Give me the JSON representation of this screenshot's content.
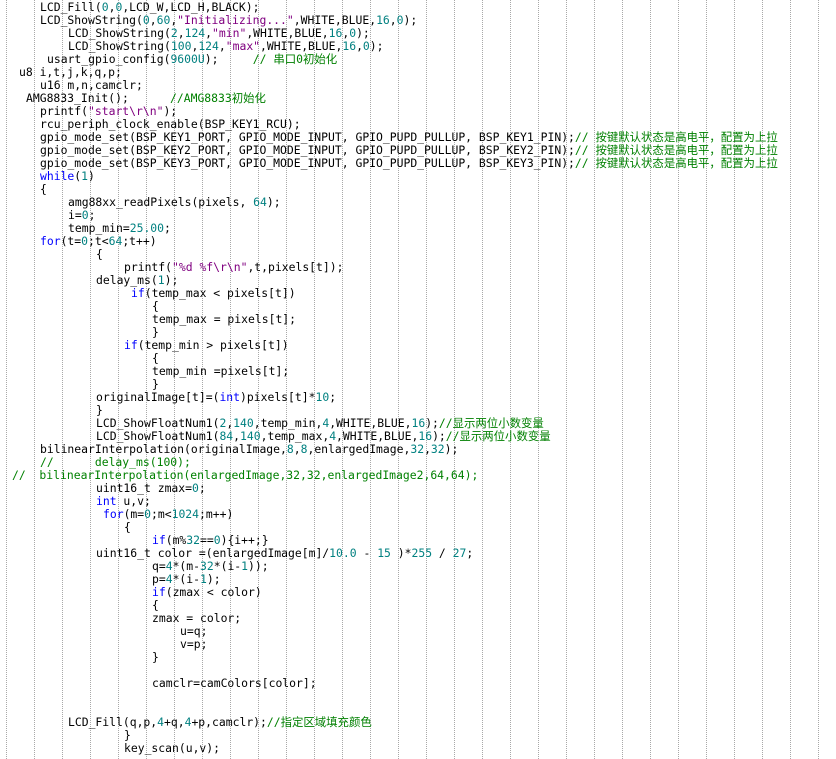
{
  "palette": {
    "text": "#000000",
    "number": "#008080",
    "string": "#800080",
    "keyword": "#0000ff",
    "comment": "#008000",
    "guide": "#a8a8a8"
  },
  "code_lines": [
    {
      "indent": 40,
      "tokens": [
        [
          "LCD_Fill(",
          ""
        ],
        [
          "0",
          "n"
        ],
        [
          ",",
          ""
        ],
        [
          "0",
          "n"
        ],
        [
          ",LCD_W,LCD_H,BLACK);",
          ""
        ]
      ]
    },
    {
      "indent": 40,
      "tokens": [
        [
          "LCD_ShowString(",
          ""
        ],
        [
          "0",
          "n"
        ],
        [
          ",",
          ""
        ],
        [
          "60",
          "n"
        ],
        [
          ",",
          ""
        ],
        [
          "\"Initializing...\"",
          "s"
        ],
        [
          ",WHITE,BLUE,",
          ""
        ],
        [
          "16",
          "n"
        ],
        [
          ",",
          ""
        ],
        [
          "0",
          "n"
        ],
        [
          ");",
          ""
        ]
      ]
    },
    {
      "indent": 68,
      "tokens": [
        [
          "LCD_ShowString(",
          ""
        ],
        [
          "2",
          "n"
        ],
        [
          ",",
          ""
        ],
        [
          "124",
          "n"
        ],
        [
          ",",
          ""
        ],
        [
          "\"min\"",
          "s"
        ],
        [
          ",WHITE,BLUE,",
          ""
        ],
        [
          "16",
          "n"
        ],
        [
          ",",
          ""
        ],
        [
          "0",
          "n"
        ],
        [
          ");",
          ""
        ]
      ]
    },
    {
      "indent": 68,
      "tokens": [
        [
          "LCD_ShowString(",
          ""
        ],
        [
          "100",
          "n"
        ],
        [
          ",",
          ""
        ],
        [
          "124",
          "n"
        ],
        [
          ",",
          ""
        ],
        [
          "\"max\"",
          "s"
        ],
        [
          ",WHITE,BLUE,",
          ""
        ],
        [
          "16",
          "n"
        ],
        [
          ",",
          ""
        ],
        [
          "0",
          "n"
        ],
        [
          ");",
          ""
        ]
      ]
    },
    {
      "indent": 47,
      "tokens": [
        [
          "usart_gpio_config(",
          ""
        ],
        [
          "9600U",
          "n"
        ],
        [
          ");     ",
          ""
        ],
        [
          "// 串口0初始化",
          "c"
        ]
      ]
    },
    {
      "indent": 19,
      "tokens": [
        [
          "u8 i,t,j,k,q,p;",
          ""
        ]
      ]
    },
    {
      "indent": 40,
      "tokens": [
        [
          "u16 m,n,camclr;",
          ""
        ]
      ]
    },
    {
      "indent": 26,
      "tokens": [
        [
          "AMG8833_Init();      ",
          ""
        ],
        [
          "//AMG8833初始化",
          "c"
        ]
      ]
    },
    {
      "indent": 40,
      "tokens": [
        [
          "printf(",
          ""
        ],
        [
          "\"start\\r\\n\"",
          "s"
        ],
        [
          ");",
          ""
        ]
      ]
    },
    {
      "indent": 40,
      "tokens": [
        [
          "rcu_periph_clock_enable(BSP_KEY1_RCU);",
          ""
        ]
      ]
    },
    {
      "indent": 40,
      "tokens": [
        [
          "gpio_mode_set(BSP_KEY1_PORT, GPIO_MODE_INPUT, GPIO_PUPD_PULLUP, BSP_KEY1_PIN);",
          ""
        ],
        [
          "// 按键默认状态是高电平，配置为上拉",
          "c"
        ]
      ]
    },
    {
      "indent": 40,
      "tokens": [
        [
          "gpio_mode_set(BSP_KEY2_PORT, GPIO_MODE_INPUT, GPIO_PUPD_PULLUP, BSP_KEY2_PIN);",
          ""
        ],
        [
          "// 按键默认状态是高电平，配置为上拉",
          "c"
        ]
      ]
    },
    {
      "indent": 40,
      "tokens": [
        [
          "gpio_mode_set(BSP_KEY3_PORT, GPIO_MODE_INPUT, GPIO_PUPD_PULLUP, BSP_KEY3_PIN);",
          ""
        ],
        [
          "// 按键默认状态是高电平，配置为上拉",
          "c"
        ]
      ]
    },
    {
      "indent": 40,
      "tokens": [
        [
          "while",
          "k"
        ],
        [
          "(",
          ""
        ],
        [
          "1",
          "n"
        ],
        [
          ")",
          ""
        ]
      ]
    },
    {
      "indent": 40,
      "tokens": [
        [
          "{",
          ""
        ]
      ]
    },
    {
      "indent": 68,
      "tokens": [
        [
          "amg88xx_readPixels(pixels, ",
          ""
        ],
        [
          "64",
          "n"
        ],
        [
          ");",
          ""
        ]
      ]
    },
    {
      "indent": 68,
      "tokens": [
        [
          "i=",
          ""
        ],
        [
          "0",
          "n"
        ],
        [
          ";",
          ""
        ]
      ]
    },
    {
      "indent": 68,
      "tokens": [
        [
          "temp_min=",
          ""
        ],
        [
          "25.00",
          "n"
        ],
        [
          ";",
          ""
        ]
      ]
    },
    {
      "indent": 40,
      "tokens": [
        [
          "for",
          "k"
        ],
        [
          "(t=",
          ""
        ],
        [
          "0",
          "n"
        ],
        [
          ";t<",
          ""
        ],
        [
          "64",
          "n"
        ],
        [
          ";t++)",
          ""
        ]
      ]
    },
    {
      "indent": 96,
      "tokens": [
        [
          "{",
          ""
        ]
      ]
    },
    {
      "indent": 124,
      "tokens": [
        [
          "printf(",
          ""
        ],
        [
          "\"%d %f\\r\\n\"",
          "s"
        ],
        [
          ",t,pixels[t]);",
          ""
        ]
      ]
    },
    {
      "indent": 96,
      "tokens": [
        [
          "delay_ms(",
          ""
        ],
        [
          "1",
          "n"
        ],
        [
          ");",
          ""
        ]
      ]
    },
    {
      "indent": 131,
      "tokens": [
        [
          "if",
          "k"
        ],
        [
          "(temp_max < pixels[t])",
          ""
        ]
      ]
    },
    {
      "indent": 152,
      "tokens": [
        [
          "{",
          ""
        ]
      ]
    },
    {
      "indent": 152,
      "tokens": [
        [
          "temp_max = pixels[t];",
          ""
        ]
      ]
    },
    {
      "indent": 152,
      "tokens": [
        [
          "}",
          ""
        ]
      ]
    },
    {
      "indent": 124,
      "tokens": [
        [
          "if",
          "k"
        ],
        [
          "(temp_min > pixels[t])",
          ""
        ]
      ]
    },
    {
      "indent": 152,
      "tokens": [
        [
          "{",
          ""
        ]
      ]
    },
    {
      "indent": 152,
      "tokens": [
        [
          "temp_min =pixels[t];",
          ""
        ]
      ]
    },
    {
      "indent": 152,
      "tokens": [
        [
          "}",
          ""
        ]
      ]
    },
    {
      "indent": 96,
      "tokens": [
        [
          "originalImage[t]=(",
          ""
        ],
        [
          "int",
          "k"
        ],
        [
          ")pixels[t]*",
          ""
        ],
        [
          "10",
          "n"
        ],
        [
          ";",
          ""
        ]
      ]
    },
    {
      "indent": 96,
      "tokens": [
        [
          "}",
          ""
        ]
      ]
    },
    {
      "indent": 96,
      "tokens": [
        [
          "LCD_ShowFloatNum1(",
          ""
        ],
        [
          "2",
          "n"
        ],
        [
          ",",
          ""
        ],
        [
          "140",
          "n"
        ],
        [
          ",temp_min,",
          ""
        ],
        [
          "4",
          "n"
        ],
        [
          ",WHITE,BLUE,",
          ""
        ],
        [
          "16",
          "n"
        ],
        [
          ");",
          ""
        ],
        [
          "//显示两位小数变量",
          "c"
        ]
      ]
    },
    {
      "indent": 96,
      "tokens": [
        [
          "LCD_ShowFloatNum1(",
          ""
        ],
        [
          "84",
          "n"
        ],
        [
          ",",
          ""
        ],
        [
          "140",
          "n"
        ],
        [
          ",temp_max,",
          ""
        ],
        [
          "4",
          "n"
        ],
        [
          ",WHITE,BLUE,",
          ""
        ],
        [
          "16",
          "n"
        ],
        [
          ");",
          ""
        ],
        [
          "//显示两位小数变量",
          "c"
        ]
      ]
    },
    {
      "indent": 40,
      "tokens": [
        [
          "bilinearInterpolation(originalImage,",
          ""
        ],
        [
          "8",
          "n"
        ],
        [
          ",",
          ""
        ],
        [
          "8",
          "n"
        ],
        [
          ",enlargedImage,",
          ""
        ],
        [
          "32",
          "n"
        ],
        [
          ",",
          ""
        ],
        [
          "32",
          "n"
        ],
        [
          ");",
          ""
        ]
      ]
    },
    {
      "indent": 40,
      "tokens": [
        [
          "//      delay_ms(100);",
          "c"
        ]
      ]
    },
    {
      "indent": 12,
      "tokens": [
        [
          "//  bilinearInterpolation(enlargedImage,32,32,enlargedImage2,64,64);",
          "c"
        ]
      ]
    },
    {
      "indent": 96,
      "tokens": [
        [
          "uint16_t zmax=",
          ""
        ],
        [
          "0",
          "n"
        ],
        [
          ";",
          ""
        ]
      ]
    },
    {
      "indent": 96,
      "tokens": [
        [
          "int",
          "k"
        ],
        [
          " u,v;",
          ""
        ]
      ]
    },
    {
      "indent": 103,
      "tokens": [
        [
          "for",
          "k"
        ],
        [
          "(m=",
          ""
        ],
        [
          "0",
          "n"
        ],
        [
          ";m<",
          ""
        ],
        [
          "1024",
          "n"
        ],
        [
          ";m++)",
          ""
        ]
      ]
    },
    {
      "indent": 124,
      "tokens": [
        [
          "{",
          ""
        ]
      ]
    },
    {
      "indent": 152,
      "tokens": [
        [
          "if",
          "k"
        ],
        [
          "(m%",
          ""
        ],
        [
          "32",
          "n"
        ],
        [
          "==",
          ""
        ],
        [
          "0",
          "n"
        ],
        [
          "){i++;}",
          ""
        ]
      ]
    },
    {
      "indent": 96,
      "tokens": [
        [
          "uint16_t color =(enlargedImage[m]/",
          ""
        ],
        [
          "10.0",
          "n"
        ],
        [
          " - ",
          ""
        ],
        [
          "15",
          "n"
        ],
        [
          " )*",
          ""
        ],
        [
          "255",
          "n"
        ],
        [
          " / ",
          ""
        ],
        [
          "27",
          "n"
        ],
        [
          ";",
          ""
        ]
      ]
    },
    {
      "indent": 152,
      "tokens": [
        [
          "q=",
          ""
        ],
        [
          "4",
          "n"
        ],
        [
          "*(m-",
          ""
        ],
        [
          "32",
          "n"
        ],
        [
          "*(i-",
          ""
        ],
        [
          "1",
          "n"
        ],
        [
          "));",
          ""
        ]
      ]
    },
    {
      "indent": 152,
      "tokens": [
        [
          "p=",
          ""
        ],
        [
          "4",
          "n"
        ],
        [
          "*(i-",
          ""
        ],
        [
          "1",
          "n"
        ],
        [
          ");",
          ""
        ]
      ]
    },
    {
      "indent": 152,
      "tokens": [
        [
          "if",
          "k"
        ],
        [
          "(zmax < color)",
          ""
        ]
      ]
    },
    {
      "indent": 152,
      "tokens": [
        [
          "{",
          ""
        ]
      ]
    },
    {
      "indent": 152,
      "tokens": [
        [
          "zmax = color;",
          ""
        ]
      ]
    },
    {
      "indent": 180,
      "tokens": [
        [
          "u=q;",
          ""
        ]
      ]
    },
    {
      "indent": 180,
      "tokens": [
        [
          "v=p;",
          ""
        ]
      ]
    },
    {
      "indent": 152,
      "tokens": [
        [
          "}",
          ""
        ]
      ]
    },
    {
      "indent": 152,
      "tokens": []
    },
    {
      "indent": 152,
      "tokens": [
        [
          "camclr=camColors[color];",
          ""
        ]
      ]
    },
    {
      "indent": 152,
      "tokens": []
    },
    {
      "indent": 152,
      "tokens": []
    },
    {
      "indent": 68,
      "tokens": [
        [
          "LCD_Fill(q,p,",
          ""
        ],
        [
          "4",
          "n"
        ],
        [
          "+q,",
          ""
        ],
        [
          "4",
          "n"
        ],
        [
          "+p,camclr);",
          ""
        ],
        [
          "//指定区域填充颜色",
          "c"
        ]
      ]
    },
    {
      "indent": 124,
      "tokens": [
        [
          "}",
          ""
        ]
      ]
    },
    {
      "indent": 124,
      "tokens": [
        [
          "key_scan(u,v);",
          ""
        ]
      ]
    }
  ]
}
